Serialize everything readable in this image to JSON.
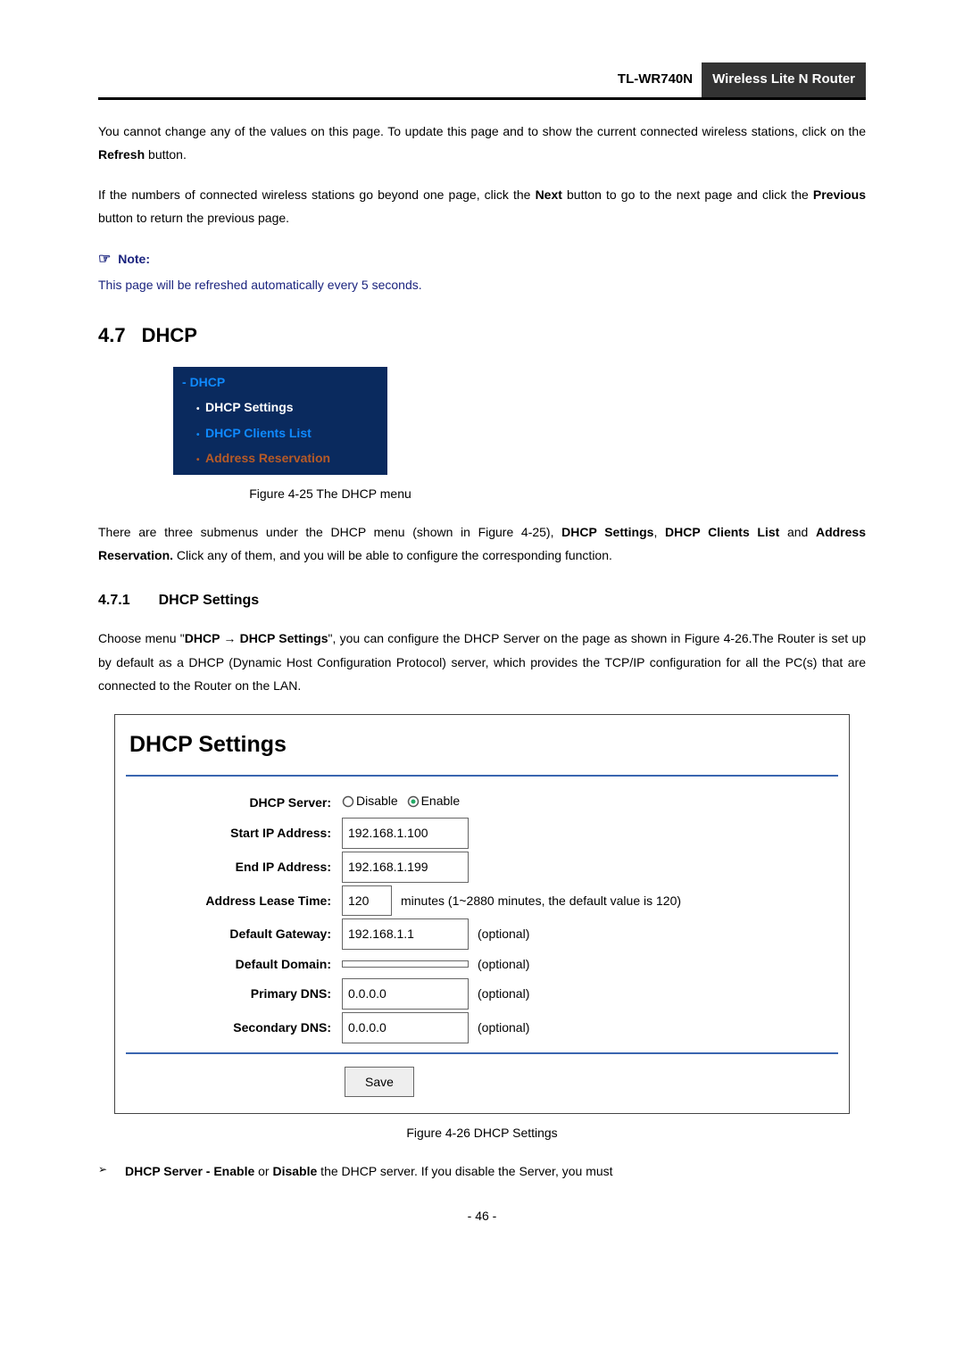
{
  "header": {
    "model": "TL-WR740N",
    "product": "Wireless  Lite  N  Router"
  },
  "para1_before": "You cannot change any of the values on this page. To update this page and to show the current connected wireless stations, click on the ",
  "para1_bold": "Refresh",
  "para1_after": " button.",
  "para2_a": "If the numbers of connected wireless stations go beyond one page, click the ",
  "para2_b": "Next",
  "para2_c": " button to go to the next page and click the ",
  "para2_d": "Previous",
  "para2_e": " button to return the previous page.",
  "note_title": "Note:",
  "note_body": "This page will be refreshed automatically every 5 seconds.",
  "sec_num": "4.7",
  "sec_title": "DHCP",
  "menu": {
    "root": "DHCP",
    "i1": "DHCP Settings",
    "i2": "DHCP Clients List",
    "i3": "Address Reservation"
  },
  "fig25": "Figure 4-25    The DHCP menu",
  "para3_a": "There  are  three  submenus  under  the  DHCP  menu  (shown  in  Figure  4-25),  ",
  "para3_b": "DHCP  Settings",
  "para3_c": ",  ",
  "para3_d": "DHCP  Clients  List",
  "para3_e": "  and  ",
  "para3_f": "Address  Reservation.",
  "para3_g": "  Click  any  of  them,  and  you  will  be  able  to configure the corresponding function.",
  "sub_num": "4.7.1",
  "sub_title": "DHCP Settings",
  "para4_a": "Choose menu \"",
  "para4_b": "DHCP",
  "para4_arrow": " → ",
  "para4_c": "DHCP Settings",
  "para4_d": "\", you can configure the DHCP Server on the page as shown in Figure 4-26.The Router is set up by default as a DHCP (Dynamic Host Configuration Protocol) server, which provides the TCP/IP configuration for all the PC(s) that are connected to the Router on the LAN.",
  "form": {
    "title": "DHCP Settings",
    "rows": {
      "dhcp_server": {
        "label": "DHCP Server:",
        "disable": "Disable",
        "enable": "Enable"
      },
      "start_ip": {
        "label": "Start IP Address:",
        "value": "192.168.1.100"
      },
      "end_ip": {
        "label": "End IP Address:",
        "value": "192.168.1.199"
      },
      "lease": {
        "label": "Address Lease Time:",
        "value": "120",
        "after": "minutes (1~2880 minutes, the default value is 120)"
      },
      "gateway": {
        "label": "Default Gateway:",
        "value": "192.168.1.1",
        "after": "(optional)"
      },
      "domain": {
        "label": "Default Domain:",
        "value": "",
        "after": "(optional)"
      },
      "pdns": {
        "label": "Primary DNS:",
        "value": "0.0.0.0",
        "after": "(optional)"
      },
      "sdns": {
        "label": "Secondary DNS:",
        "value": "0.0.0.0",
        "after": "(optional)"
      }
    },
    "save": "Save"
  },
  "fig26": "Figure 4-26 DHCP Settings",
  "bullet1_a": "DHCP Server - Enable",
  "bullet1_b": " or ",
  "bullet1_c": "Disable",
  "bullet1_d": " the DHCP server. If you disable the Server, you must",
  "page_num": "- 46 -"
}
